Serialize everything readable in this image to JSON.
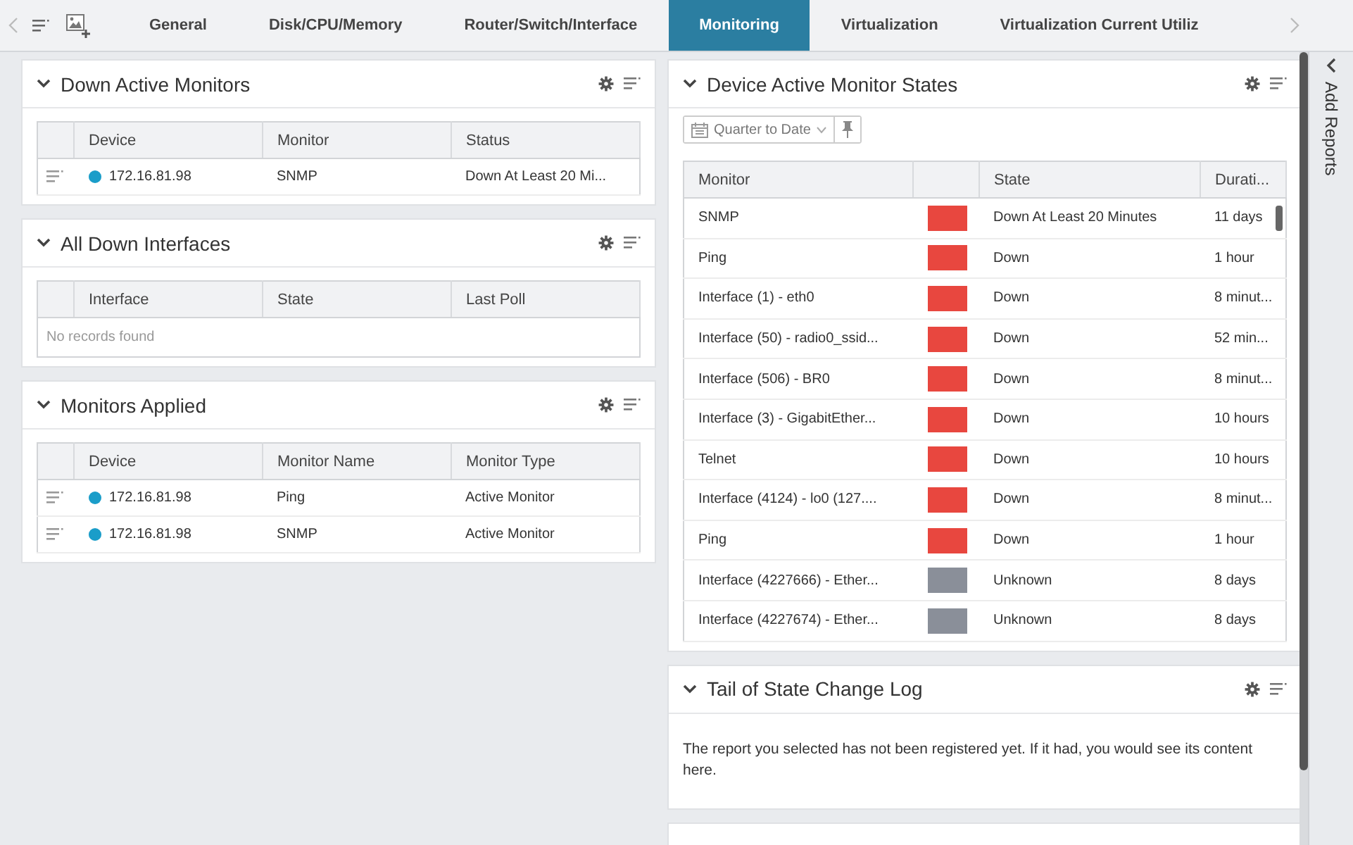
{
  "tabbar": {
    "tabs": [
      {
        "label": "General",
        "selected": false
      },
      {
        "label": "Disk/CPU/Memory",
        "selected": false
      },
      {
        "label": "Router/Switch/Interface",
        "selected": false
      },
      {
        "label": "Monitoring",
        "selected": true
      },
      {
        "label": "Virtualization",
        "selected": false
      },
      {
        "label": "Virtualization Current Utiliz",
        "selected": false
      }
    ]
  },
  "left_panels": [
    {
      "title": "Down Active Monitors",
      "table": {
        "columns": [
          "Device",
          "Monitor",
          "Status"
        ],
        "rows": [
          [
            "172.16.81.98",
            "SNMP",
            "Down At Least 20 Mi..."
          ]
        ]
      }
    },
    {
      "title": "All Down Interfaces",
      "table": {
        "columns": [
          "Interface",
          "State",
          "Last Poll"
        ],
        "empty_message": "No records found"
      }
    },
    {
      "title": "Monitors Applied",
      "table": {
        "columns": [
          "Device",
          "Monitor Name",
          "Monitor Type"
        ],
        "rows": [
          [
            "172.16.81.98",
            "Ping",
            "Active Monitor"
          ],
          [
            "172.16.81.98",
            "SNMP",
            "Active Monitor"
          ]
        ]
      }
    }
  ],
  "right_panels": [
    {
      "title": "Device Active Monitor States",
      "date_filter": "Quarter to Date",
      "table": {
        "columns": [
          "Monitor",
          "State",
          "Durati..."
        ],
        "rows": [
          {
            "monitor": "SNMP",
            "color": "#e8473f",
            "state": "Down At Least 20 Minutes",
            "duration": "11 days"
          },
          {
            "monitor": "Ping",
            "color": "#e8473f",
            "state": "Down",
            "duration": "1 hour"
          },
          {
            "monitor": "Interface (1) - eth0",
            "color": "#e8473f",
            "state": "Down",
            "duration": "8 minut..."
          },
          {
            "monitor": "Interface (50) - radio0_ssid...",
            "color": "#e8473f",
            "state": "Down",
            "duration": "52 min..."
          },
          {
            "monitor": "Interface (506) - BR0",
            "color": "#e8473f",
            "state": "Down",
            "duration": "8 minut..."
          },
          {
            "monitor": "Interface (3) - GigabitEther...",
            "color": "#e8473f",
            "state": "Down",
            "duration": "10 hours"
          },
          {
            "monitor": "Telnet",
            "color": "#e8473f",
            "state": "Down",
            "duration": "10 hours"
          },
          {
            "monitor": "Interface (4124) - lo0 (127....",
            "color": "#e8473f",
            "state": "Down",
            "duration": "8 minut..."
          },
          {
            "monitor": "Ping",
            "color": "#e8473f",
            "state": "Down",
            "duration": "1 hour"
          },
          {
            "monitor": "Interface (4227666) - Ether...",
            "color": "#8a8f99",
            "state": "Unknown",
            "duration": "8 days"
          },
          {
            "monitor": "Interface (4227674) - Ether...",
            "color": "#8a8f99",
            "state": "Unknown",
            "duration": "8 days"
          }
        ]
      }
    },
    {
      "title": "Tail of State Change Log",
      "message": "The report you selected has not been registered yet. If it had, you would see its content here."
    }
  ],
  "sidebar": {
    "label": "Add Reports"
  }
}
